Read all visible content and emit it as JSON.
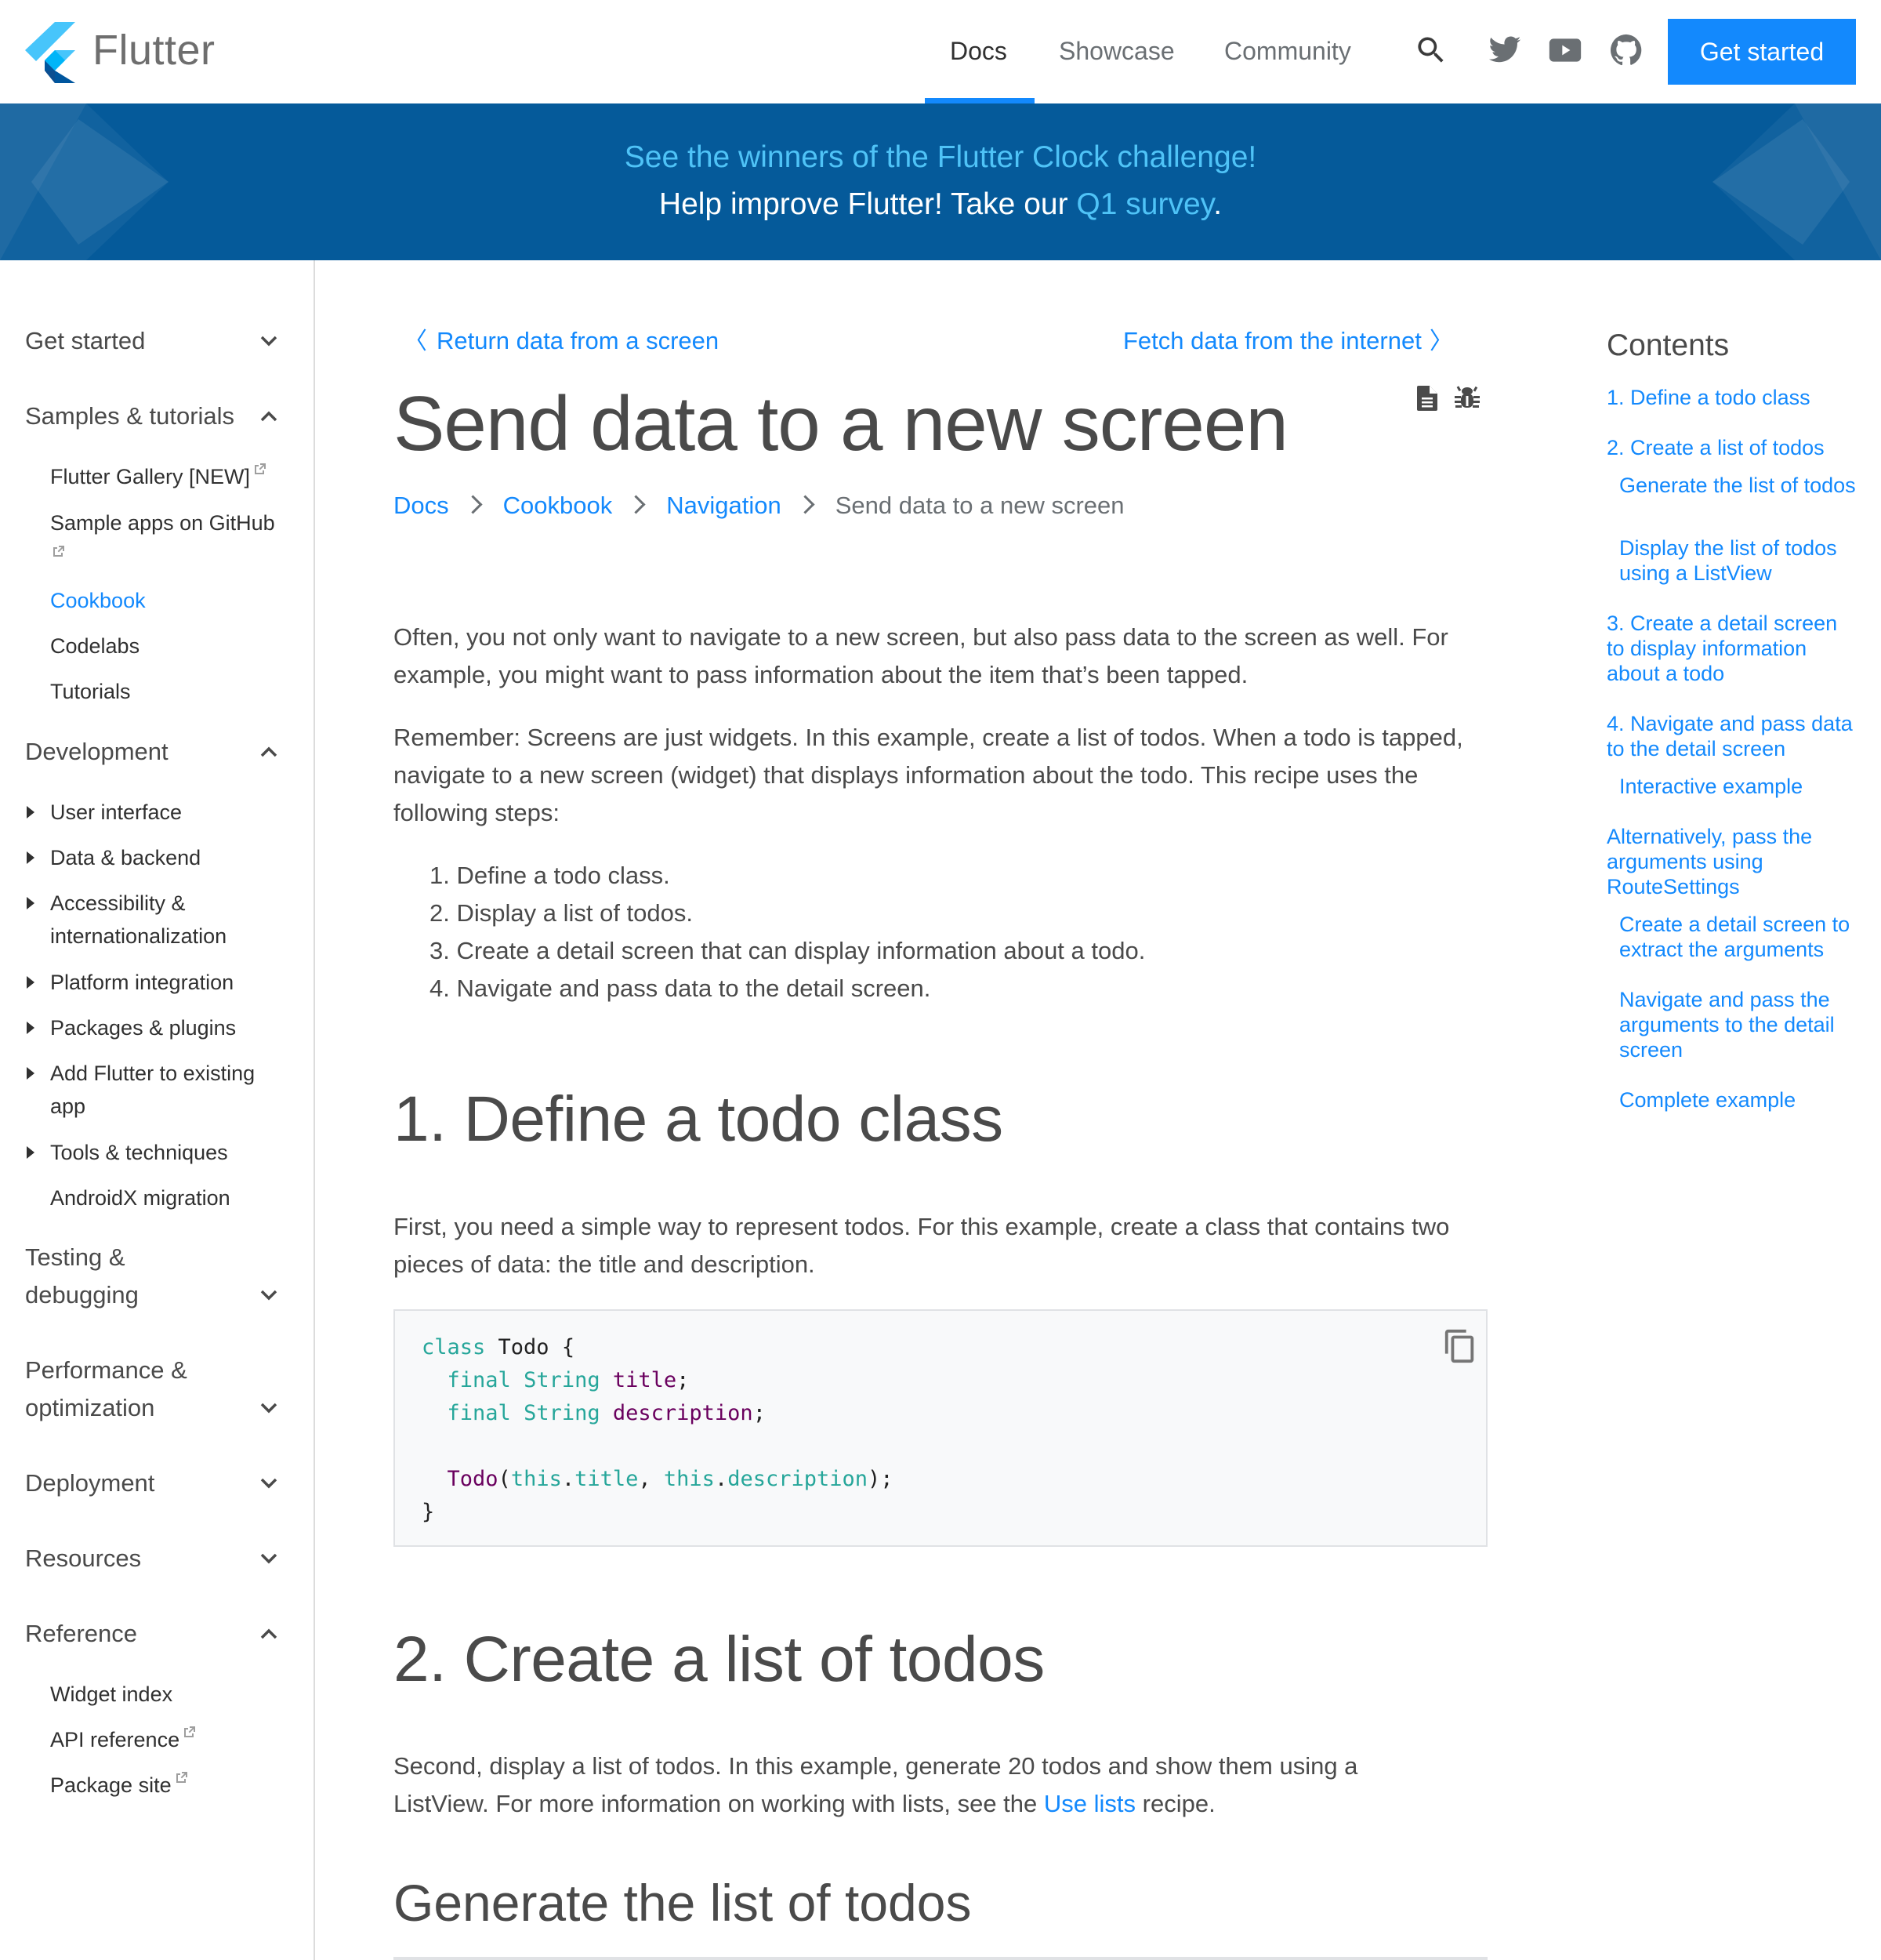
{
  "header": {
    "brand": "Flutter",
    "nav": [
      {
        "label": "Docs",
        "active": true
      },
      {
        "label": "Showcase",
        "active": false
      },
      {
        "label": "Community",
        "active": false
      }
    ],
    "icons": [
      "search-icon",
      "twitter-icon",
      "youtube-icon",
      "github-icon"
    ],
    "cta_label": "Get started",
    "accent": "#1389fd"
  },
  "banner": {
    "line1": "See the winners of the Flutter Clock challenge!",
    "line2_prefix": "Help improve Flutter! Take our ",
    "line2_link": "Q1 survey",
    "line2_suffix": ".",
    "background": "#055a9a"
  },
  "sidebar": {
    "sections": [
      {
        "label": "Get started",
        "expanded": false
      },
      {
        "label": "Samples & tutorials",
        "expanded": true,
        "items": [
          {
            "label": "Flutter Gallery [NEW]",
            "external": true
          },
          {
            "label": "Sample apps on GitHub",
            "external": true
          },
          {
            "label": "Cookbook",
            "active": true
          },
          {
            "label": "Codelabs"
          },
          {
            "label": "Tutorials"
          }
        ]
      },
      {
        "label": "Development",
        "expanded": true,
        "items": [
          {
            "label": "User interface",
            "collapsible": true
          },
          {
            "label": "Data & backend",
            "collapsible": true
          },
          {
            "label": "Accessibility & internationalization",
            "collapsible": true
          },
          {
            "label": "Platform integration",
            "collapsible": true
          },
          {
            "label": "Packages & plugins",
            "collapsible": true
          },
          {
            "label": "Add Flutter to existing app",
            "collapsible": true
          },
          {
            "label": "Tools & techniques",
            "collapsible": true
          },
          {
            "label": "AndroidX migration"
          }
        ]
      },
      {
        "label": "Testing & debugging",
        "expanded": false
      },
      {
        "label": "Performance & optimization",
        "expanded": false
      },
      {
        "label": "Deployment",
        "expanded": false
      },
      {
        "label": "Resources",
        "expanded": false
      },
      {
        "label": "Reference",
        "expanded": true,
        "items": [
          {
            "label": "Widget index"
          },
          {
            "label": "API reference",
            "external": true
          },
          {
            "label": "Package site",
            "external": true
          }
        ]
      }
    ]
  },
  "main": {
    "prev_link": "Return data from a screen",
    "next_link": "Fetch data from the internet",
    "title": "Send data to a new screen",
    "title_icons": [
      "page-source-icon",
      "bug-report-icon"
    ],
    "breadcrumb": [
      "Docs",
      "Cookbook",
      "Navigation",
      "Send data to a new screen"
    ],
    "intro_p1": "Often, you not only want to navigate to a new screen, but also pass data to the screen as well. For example, you might want to pass information about the item that’s been tapped.",
    "intro_p2": "Remember: Screens are just widgets. In this example, create a list of todos. When a todo is tapped, navigate to a new screen (widget) that displays information about the todo. This recipe uses the following steps:",
    "steps": [
      "1. Define a todo class.",
      "2. Display a list of todos.",
      "3. Create a detail screen that can display information about a todo.",
      "4. Navigate and pass data to the detail screen."
    ],
    "h_define": "1. Define a todo class",
    "p_define": "First, you need a simple way to represent todos. For this example, create a class that contains two pieces of data: the title and description.",
    "code": {
      "lines": [
        [
          {
            "t": "class",
            "c": "kw"
          },
          {
            "t": " Todo {",
            "c": ""
          }
        ],
        [
          {
            "t": "  ",
            "c": ""
          },
          {
            "t": "final",
            "c": "kw"
          },
          {
            "t": " ",
            "c": ""
          },
          {
            "t": "String",
            "c": "ty"
          },
          {
            "t": " ",
            "c": ""
          },
          {
            "t": "title",
            "c": "vr"
          },
          {
            "t": ";",
            "c": ""
          }
        ],
        [
          {
            "t": "  ",
            "c": ""
          },
          {
            "t": "final",
            "c": "kw"
          },
          {
            "t": " ",
            "c": ""
          },
          {
            "t": "String",
            "c": "ty"
          },
          {
            "t": " ",
            "c": ""
          },
          {
            "t": "description",
            "c": "vr"
          },
          {
            "t": ";",
            "c": ""
          }
        ],
        [
          {
            "t": "",
            "c": ""
          }
        ],
        [
          {
            "t": "  ",
            "c": ""
          },
          {
            "t": "Todo",
            "c": "vr"
          },
          {
            "t": "(",
            "c": ""
          },
          {
            "t": "this",
            "c": "kw"
          },
          {
            "t": ".",
            "c": ""
          },
          {
            "t": "title",
            "c": "kw"
          },
          {
            "t": ", ",
            "c": ""
          },
          {
            "t": "this",
            "c": "kw"
          },
          {
            "t": ".",
            "c": ""
          },
          {
            "t": "description",
            "c": "kw"
          },
          {
            "t": ");",
            "c": ""
          }
        ],
        [
          {
            "t": "}",
            "c": ""
          }
        ]
      ],
      "copy_icon": "copy-icon"
    },
    "h_create": "2. Create a list of todos",
    "p_create_prefix": "Second, display a list of todos. In this example, generate 20 todos and show them using a ListView. For more information on working with lists, see the ",
    "p_create_link": "Use lists",
    "p_create_suffix": " recipe.",
    "h_generate": "Generate the list of todos"
  },
  "toc": {
    "title": "Contents",
    "items": [
      {
        "label": "1. Define a todo class",
        "sub": false
      },
      {
        "label": "2. Create a list of todos",
        "sub": false
      },
      {
        "label": "Generate the list of todos",
        "sub": true
      },
      {
        "label": "Display the list of todos using a ListView",
        "sub": true
      },
      {
        "label": "3. Create a detail screen to display information about a todo",
        "sub": false
      },
      {
        "label": "4. Navigate and pass data to the detail screen",
        "sub": false
      },
      {
        "label": "Interactive example",
        "sub": true
      },
      {
        "label": "Alternatively, pass the arguments using RouteSettings",
        "sub": false
      },
      {
        "label": "Create a detail screen to extract the arguments",
        "sub": true
      },
      {
        "label": "Navigate and pass the arguments to the detail screen",
        "sub": true
      },
      {
        "label": "Complete example",
        "sub": true
      }
    ]
  }
}
